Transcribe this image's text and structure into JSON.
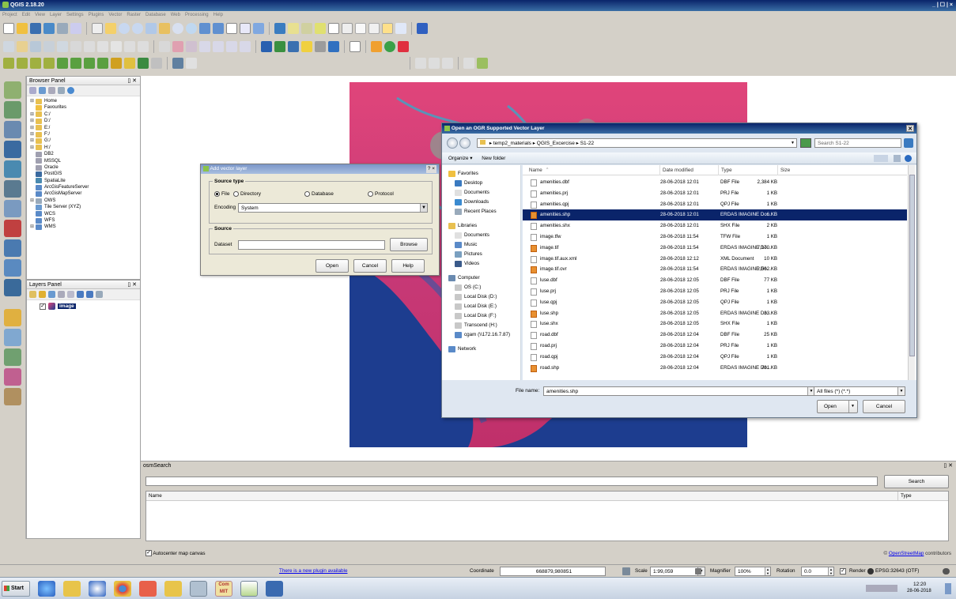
{
  "app": {
    "title": "QGIS 2.18.20",
    "win_ctrl": "_ | ☐ | ×"
  },
  "menu": [
    "Project",
    "Edit",
    "View",
    "Layer",
    "Settings",
    "Plugins",
    "Vector",
    "Raster",
    "Database",
    "Web",
    "Processing",
    "Help"
  ],
  "browser_panel": {
    "title": "Browser Panel",
    "items": [
      {
        "label": "Home",
        "icon": "folder-icon",
        "indent": 1,
        "expand": "⊞"
      },
      {
        "label": "Favourites",
        "icon": "star-icon",
        "indent": 1,
        "expand": ""
      },
      {
        "label": "C:/",
        "icon": "drive-icon",
        "indent": 1,
        "expand": "⊞"
      },
      {
        "label": "D:/",
        "icon": "drive-icon",
        "indent": 1,
        "expand": "⊞"
      },
      {
        "label": "E:/",
        "icon": "drive-icon",
        "indent": 1,
        "expand": "⊞"
      },
      {
        "label": "F:/",
        "icon": "drive-icon",
        "indent": 1,
        "expand": "⊞"
      },
      {
        "label": "G:/",
        "icon": "drive-icon",
        "indent": 1,
        "expand": "⊞"
      },
      {
        "label": "H:/",
        "icon": "drive-icon",
        "indent": 1,
        "expand": "⊞"
      },
      {
        "label": "DB2",
        "icon": "database-icon",
        "indent": 1,
        "expand": ""
      },
      {
        "label": "MSSQL",
        "icon": "database-icon",
        "indent": 1,
        "expand": ""
      },
      {
        "label": "Oracle",
        "icon": "database-icon",
        "indent": 1,
        "expand": ""
      },
      {
        "label": "PostGIS",
        "icon": "postgis-icon",
        "indent": 1,
        "expand": ""
      },
      {
        "label": "SpatiaLite",
        "icon": "spatialite-icon",
        "indent": 1,
        "expand": ""
      },
      {
        "label": "ArcGisFeatureServer",
        "icon": "arcgis-icon",
        "indent": 1,
        "expand": ""
      },
      {
        "label": "ArcGisMapServer",
        "icon": "arcgis-icon",
        "indent": 1,
        "expand": ""
      },
      {
        "label": "OWS",
        "icon": "ows-icon",
        "indent": 1,
        "expand": "⊞"
      },
      {
        "label": "Tile Server (XYZ)",
        "icon": "tile-icon",
        "indent": 1,
        "expand": ""
      },
      {
        "label": "WCS",
        "icon": "globe-icon",
        "indent": 1,
        "expand": ""
      },
      {
        "label": "WFS",
        "icon": "globe-icon",
        "indent": 1,
        "expand": ""
      },
      {
        "label": "WMS",
        "icon": "globe-icon",
        "indent": 1,
        "expand": "⊞"
      }
    ]
  },
  "layers_panel": {
    "title": "Layers Panel",
    "layer": "image"
  },
  "add_vector": {
    "title": "Add vector layer",
    "title_btns": "? ×",
    "source_type_label": "Source type",
    "options": [
      "File",
      "Directory",
      "Database",
      "Protocol"
    ],
    "encoding_label": "Encoding",
    "encoding_value": "System",
    "source_label": "Source",
    "dataset_label": "Dataset",
    "browse": "Browse",
    "open": "Open",
    "cancel": "Cancel",
    "help": "Help"
  },
  "ogr_dialog": {
    "title": "Open an OGR Supported Vector Layer",
    "path": "▸ temp2_materials ▸ QGIS_Excercise ▸ S1-22",
    "search_placeholder": "Search S1-22",
    "organize": "Organize ▾",
    "new_folder": "New folder",
    "columns": [
      "Name",
      "Date modified",
      "Type",
      "Size"
    ],
    "nav": [
      {
        "label": "Favorites",
        "icon": "star"
      },
      {
        "label": "Desktop",
        "icon": "desktop"
      },
      {
        "label": "Documents",
        "icon": "doc"
      },
      {
        "label": "Downloads",
        "icon": "down"
      },
      {
        "label": "Recent Places",
        "icon": "recent"
      },
      {
        "label": "",
        "icon": ""
      },
      {
        "label": "Libraries",
        "icon": "lib"
      },
      {
        "label": "Documents",
        "icon": "doc"
      },
      {
        "label": "Music",
        "icon": "music"
      },
      {
        "label": "Pictures",
        "icon": "pic"
      },
      {
        "label": "Videos",
        "icon": "video"
      },
      {
        "label": "",
        "icon": ""
      },
      {
        "label": "Computer",
        "icon": "comp"
      },
      {
        "label": "OS (C:)",
        "icon": "disk"
      },
      {
        "label": "Local Disk (D:)",
        "icon": "disk"
      },
      {
        "label": "Local Disk (E:)",
        "icon": "disk"
      },
      {
        "label": "Local Disk (F:)",
        "icon": "disk"
      },
      {
        "label": "Transcend (H:)",
        "icon": "disk"
      },
      {
        "label": "cgam (\\\\172.16.7.87)",
        "icon": "net"
      },
      {
        "label": "",
        "icon": ""
      },
      {
        "label": "Network",
        "icon": "net"
      }
    ],
    "files": [
      {
        "name": "amenities.dbf",
        "date": "28-06-2018 12:01",
        "type": "DBF File",
        "size": "2,384 KB",
        "icon": "dbf"
      },
      {
        "name": "amenities.prj",
        "date": "28-06-2018 12:01",
        "type": "PRJ File",
        "size": "1 KB",
        "icon": "doc"
      },
      {
        "name": "amenities.qpj",
        "date": "28-06-2018 12:01",
        "type": "QPJ File",
        "size": "1 KB",
        "icon": "doc"
      },
      {
        "name": "amenities.shp",
        "date": "28-06-2018 12:01",
        "type": "ERDAS IMAGINE Do...",
        "size": "6 KB",
        "icon": "erdas",
        "selected": true
      },
      {
        "name": "amenities.shx",
        "date": "28-06-2018 12:01",
        "type": "SHX File",
        "size": "2 KB",
        "icon": "doc"
      },
      {
        "name": "image.tfw",
        "date": "28-06-2018 11:54",
        "type": "TFW File",
        "size": "1 KB",
        "icon": "doc"
      },
      {
        "name": "image.tif",
        "date": "28-06-2018 11:54",
        "type": "ERDAS IMAGINE Do...",
        "size": "7,170 KB",
        "icon": "erdas"
      },
      {
        "name": "image.tif.aux.xml",
        "date": "28-06-2018 12:12",
        "type": "XML Document",
        "size": "10 KB",
        "icon": "xml"
      },
      {
        "name": "image.tif.ovr",
        "date": "28-06-2018 11:54",
        "type": "ERDAS IMAGINE Do...",
        "size": "2,562 KB",
        "icon": "erdas"
      },
      {
        "name": "luse.dbf",
        "date": "28-06-2018 12:05",
        "type": "DBF File",
        "size": "77 KB",
        "icon": "dbf"
      },
      {
        "name": "luse.prj",
        "date": "28-06-2018 12:05",
        "type": "PRJ File",
        "size": "1 KB",
        "icon": "doc"
      },
      {
        "name": "luse.qpj",
        "date": "28-06-2018 12:05",
        "type": "QPJ File",
        "size": "1 KB",
        "icon": "doc"
      },
      {
        "name": "luse.shp",
        "date": "28-06-2018 12:05",
        "type": "ERDAS IMAGINE Do...",
        "size": "33 KB",
        "icon": "erdas"
      },
      {
        "name": "luse.shx",
        "date": "28-06-2018 12:05",
        "type": "SHX File",
        "size": "1 KB",
        "icon": "doc"
      },
      {
        "name": "road.dbf",
        "date": "28-06-2018 12:04",
        "type": "DBF File",
        "size": "25 KB",
        "icon": "dbf"
      },
      {
        "name": "road.prj",
        "date": "28-06-2018 12:04",
        "type": "PRJ File",
        "size": "1 KB",
        "icon": "doc"
      },
      {
        "name": "road.qpj",
        "date": "28-06-2018 12:04",
        "type": "QPJ File",
        "size": "1 KB",
        "icon": "doc"
      },
      {
        "name": "road.shp",
        "date": "28-06-2018 12:04",
        "type": "ERDAS IMAGINE Do...",
        "size": "781 KB",
        "icon": "erdas"
      }
    ],
    "filename_label": "File name:",
    "filename_value": "amenities.shp",
    "filter": "All files (*) (*.*)",
    "open": "Open",
    "cancel": "Cancel"
  },
  "osm": {
    "title": "osmSearch",
    "search": "Search",
    "col_name": "Name",
    "col_type": "Type",
    "autocenter": "Autocenter map canvas",
    "credit": "© OpenStreetMap contributors"
  },
  "status": {
    "plugin": "There is a new plugin available",
    "coordinate_label": "Coordinate",
    "coordinate": "668879,980851",
    "scale_label": "Scale",
    "scale": "1:99,059",
    "magnifier_label": "Magnifier",
    "magnifier": "100%",
    "rotation_label": "Rotation",
    "rotation": "0.0",
    "render": "Render",
    "epsg": "EPSG:32643 (OTF)"
  },
  "taskbar": {
    "start": "Start",
    "time": "12:20",
    "date": "28-06-2018",
    "commit_label": "Com MIT"
  },
  "colors": {
    "titlebar": "#0a246a",
    "selected": "#0a246a",
    "map_pink": "#e0457a",
    "map_blue": "#1d3d8f",
    "link": "#0000ee"
  }
}
